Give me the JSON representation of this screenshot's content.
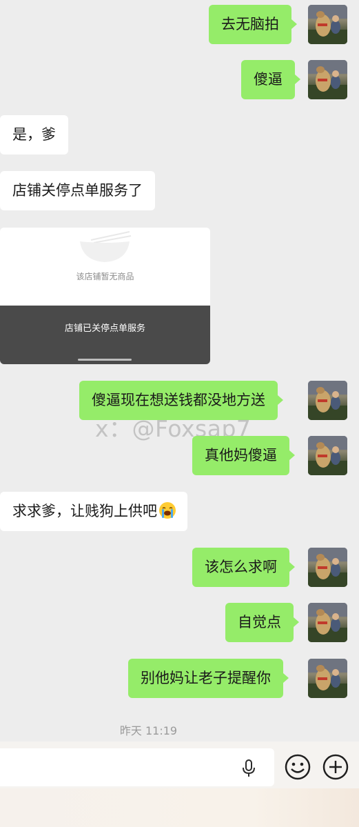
{
  "messages": [
    {
      "side": "right",
      "text": "去无脑拍"
    },
    {
      "side": "right",
      "text": "傻逼"
    },
    {
      "side": "left",
      "text": "是，爹"
    },
    {
      "side": "left",
      "text": "店铺关停点单服务了"
    },
    {
      "side": "right",
      "text": "傻逼现在想送钱都没地方送"
    },
    {
      "side": "right",
      "text": "真他妈傻逼"
    },
    {
      "side": "left",
      "text": "求求爹，让贱狗上供吧"
    },
    {
      "side": "right",
      "text": "该怎么求啊"
    },
    {
      "side": "right",
      "text": "自觉点"
    },
    {
      "side": "right",
      "text": "别他妈让老子提醒你"
    }
  ],
  "card": {
    "empty_text": "该店铺暂无商品",
    "closed_text": "店铺已关停点单服务"
  },
  "watermark": "x：@Foxsap7",
  "timestamp": "昨天 11:19",
  "icons": {
    "emoji": "loudly-crying-face",
    "voice": "microphone-icon",
    "emoji_button": "smiley-icon",
    "more": "plus-icon"
  },
  "colors": {
    "bubble_right": "#95ec69",
    "bubble_left": "#ffffff",
    "background": "#ededed"
  }
}
